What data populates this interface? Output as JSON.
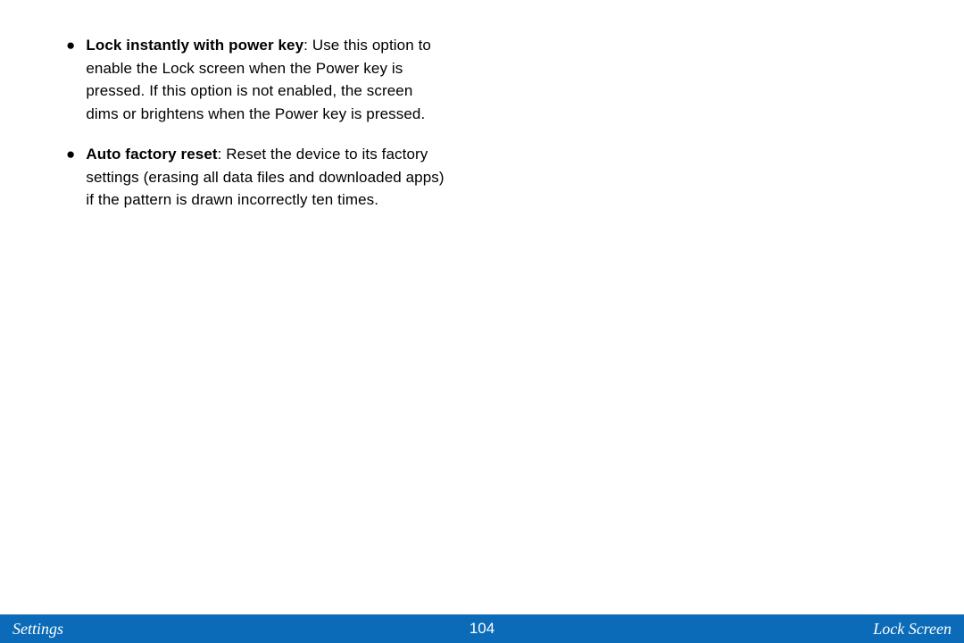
{
  "content": {
    "items": [
      {
        "title": "Lock instantly with power key",
        "body": ": Use this option to enable the Lock screen when the Power key is pressed. If this option is not enabled, the screen dims or brightens when the Power key is pressed."
      },
      {
        "title": "Auto factory reset",
        "body": ": Reset the device to its factory settings (erasing all data files and downloaded apps) if the pattern is drawn incorrectly ten times."
      }
    ]
  },
  "footer": {
    "left": "Settings",
    "center": "104",
    "right": "Lock Screen"
  }
}
